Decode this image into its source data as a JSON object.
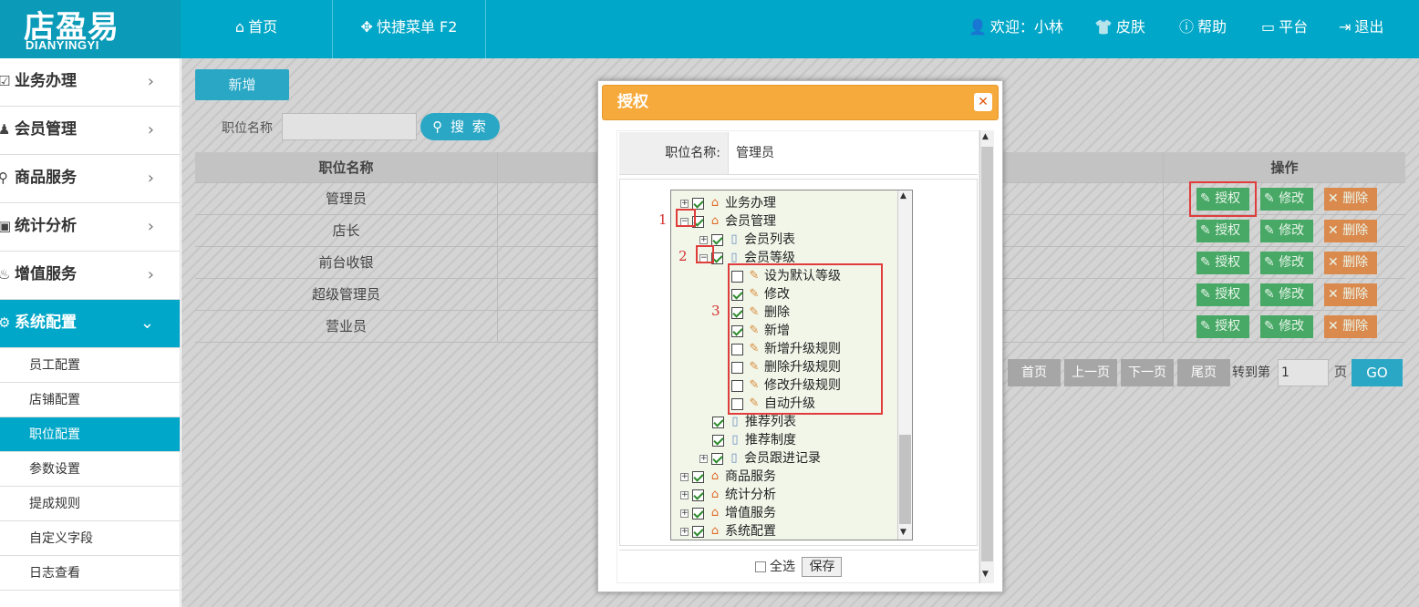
{
  "app": {
    "logo_text": "店盈易",
    "logo_sub": "DIANYINGYI"
  },
  "topnav": {
    "home": "首页",
    "quick_menu": "快捷菜单 F2"
  },
  "topright": {
    "welcome": "欢迎：小林",
    "skin": "皮肤",
    "help": "帮助",
    "platform": "平台",
    "logout": "退出"
  },
  "sidebar": {
    "modules": [
      {
        "label": "业务办理"
      },
      {
        "label": "会员管理"
      },
      {
        "label": "商品服务"
      },
      {
        "label": "统计分析"
      },
      {
        "label": "增值服务"
      },
      {
        "label": "系统配置"
      }
    ],
    "subitems": [
      "员工配置",
      "店铺配置",
      "职位配置",
      "参数设置",
      "提成规则",
      "自定义字段",
      "日志查看"
    ]
  },
  "toolbar": {
    "new_label": "新增",
    "search_label": "职位名称",
    "search_button": "搜 索"
  },
  "table": {
    "headers": [
      "职位名称",
      "操作"
    ],
    "rows": [
      "管理员",
      "店长",
      "前台收银",
      "超级管理员",
      "营业员"
    ],
    "actions": {
      "auth": "授权",
      "edit": "修改",
      "delete": "删除"
    }
  },
  "pager": {
    "first": "首页",
    "prev": "上一页",
    "next": "下一页",
    "last": "尾页",
    "goto_prefix": "转到第",
    "page_value": "1",
    "goto_suffix": "页",
    "go": "GO"
  },
  "dialog": {
    "title": "授权",
    "position_label": "职位名称:",
    "position_value": "管理员",
    "select_all": "全选",
    "save": "保存",
    "annotations": [
      "1",
      "2",
      "3"
    ],
    "tree": {
      "n1": "业务办理",
      "n2": "会员管理",
      "n2a": "会员列表",
      "n2b": "会员等级",
      "p1": "设为默认等级",
      "p2": "修改",
      "p3": "删除",
      "p4": "新增",
      "p5": "新增升级规则",
      "p6": "删除升级规则",
      "p7": "修改升级规则",
      "p8": "自动升级",
      "n2c": "推荐列表",
      "n2d": "推荐制度",
      "n2e": "会员跟进记录",
      "n3": "商品服务",
      "n4": "统计分析",
      "n5": "增值服务",
      "n6": "系统配置"
    }
  },
  "colors": {
    "primary": "#00a7c8",
    "dialog_header": "#f6aa3c",
    "auth_button": "#48a866",
    "delete_button": "#db8a4e",
    "highlight": "#e03c3c"
  }
}
